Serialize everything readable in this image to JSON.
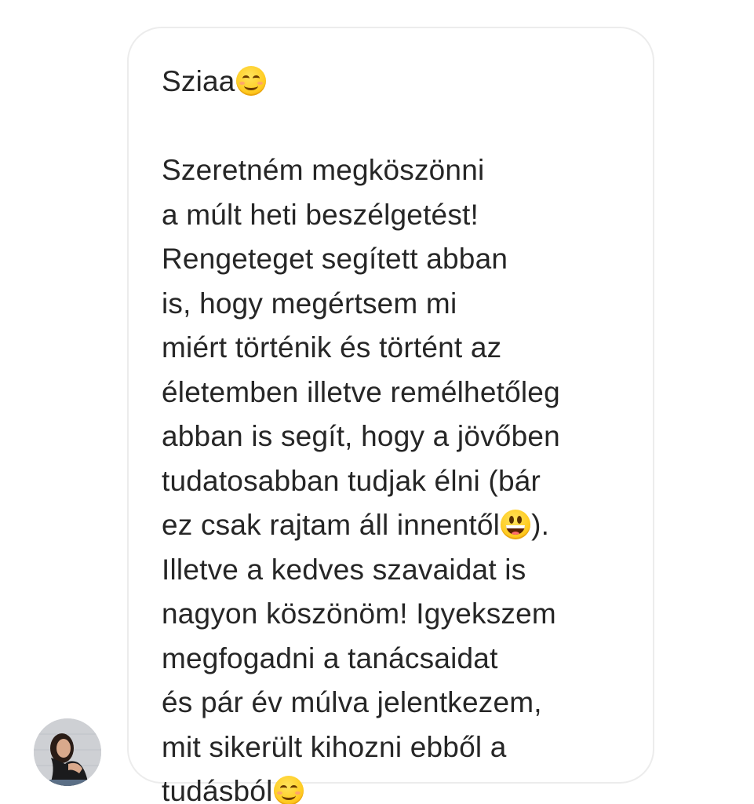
{
  "conversation": {
    "message": {
      "lines": [
        {
          "text": "Sziaa",
          "emoji_after": "smiling-face-with-smiling-eyes"
        },
        {
          "text": ""
        },
        {
          "text": "Szeretném megköszönni"
        },
        {
          "text": "a múlt heti beszélgetést!"
        },
        {
          "text": "Rengeteget segített abban"
        },
        {
          "text": "is, hogy megértsem mi"
        },
        {
          "text": "miért történik és történt az"
        },
        {
          "text": "életemben illetve remélhetőleg"
        },
        {
          "text": "abban is segít, hogy a jövőben"
        },
        {
          "text": "tudatosabban tudjak élni (bár"
        },
        {
          "text": "ez csak rajtam áll innentől",
          "emoji_after": "grinning-face-with-big-eyes",
          "text_after": ")."
        },
        {
          "text": "Illetve a kedves szavaidat is"
        },
        {
          "text": "nagyon köszönöm! Igyekszem"
        },
        {
          "text": "megfogadni a tanácsaidat"
        },
        {
          "text": "és pár év múlva jelentkezem,"
        },
        {
          "text": "mit sikerült kihozni ebből a"
        },
        {
          "text": "tudásból",
          "emoji_after": "smiling-face-with-smiling-eyes"
        }
      ]
    },
    "sender": {
      "avatar_icon": "sender-avatar-photo"
    },
    "colors": {
      "text": "#262626",
      "bubble_border": "#ececec",
      "background": "#ffffff",
      "emoji_yellow": "#ffcc22"
    }
  }
}
